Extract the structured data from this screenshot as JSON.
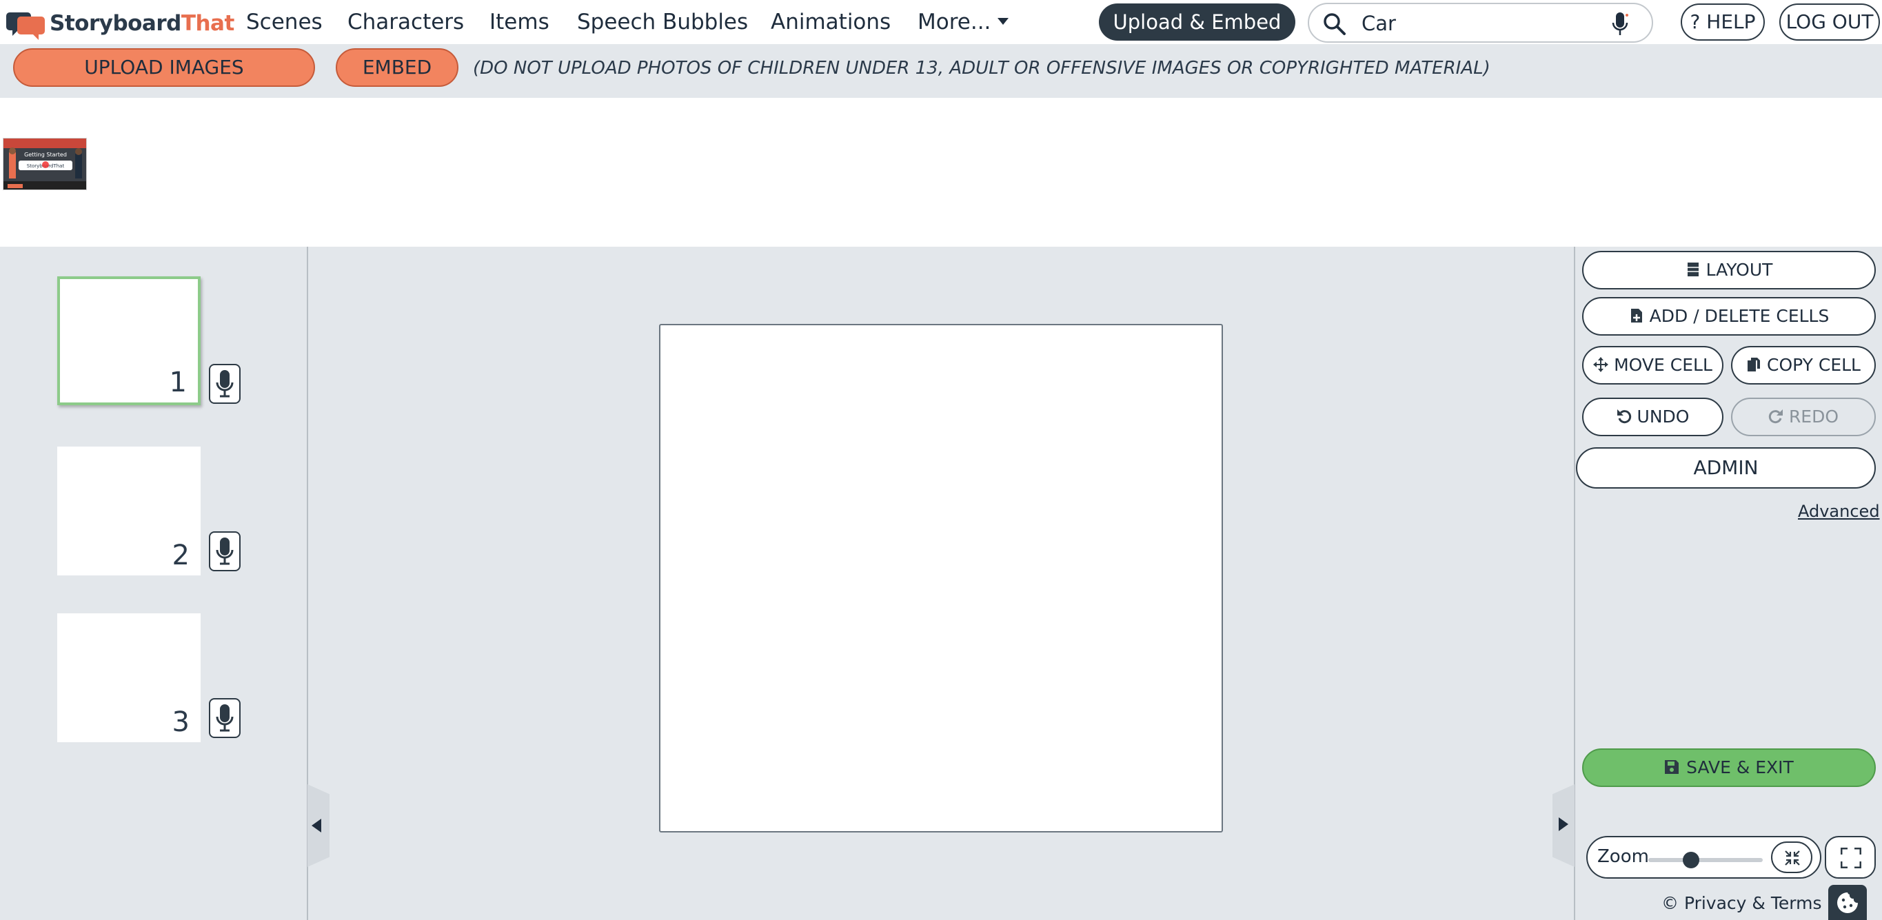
{
  "brand": {
    "name_part1": "Storyboard",
    "name_part2": "That"
  },
  "nav": {
    "scenes": "Scenes",
    "characters": "Characters",
    "items": "Items",
    "speech_bubbles": "Speech Bubbles",
    "animations": "Animations",
    "more": "More..."
  },
  "header": {
    "upload_embed": "Upload & Embed",
    "search": {
      "value": "Car",
      "icon": "search-icon",
      "voice_icon": "microphone-icon"
    },
    "help": "? HELP",
    "logout": "LOG OUT"
  },
  "upload_strip": {
    "upload_images": "UPLOAD IMAGES",
    "embed": "EMBED",
    "warning": "(DO NOT UPLOAD PHOTOS OF CHILDREN UNDER 13, ADULT OR OFFENSIVE IMAGES OR COPYRIGHTED MATERIAL)"
  },
  "library": {
    "thumbnail": {
      "title": "Getting Started",
      "brand": "StoryboardThat"
    }
  },
  "cells": [
    {
      "number": "1",
      "active": true
    },
    {
      "number": "2",
      "active": false
    },
    {
      "number": "3",
      "active": false
    }
  ],
  "tools": {
    "layout": "LAYOUT",
    "add_delete_cells": "ADD / DELETE CELLS",
    "move_cell": "MOVE CELL",
    "copy_cell": "COPY CELL",
    "undo": "UNDO",
    "redo": "REDO",
    "admin": "ADMIN",
    "advanced": "Advanced",
    "save_exit": "SAVE & EXIT"
  },
  "zoom": {
    "label": "Zoom",
    "level": 0.35
  },
  "footer": {
    "privacy": "© Privacy & Terms"
  },
  "colors": {
    "accent_orange": "#f2845f",
    "brand_dark": "#2d3a45",
    "save_green": "#6fbf6a",
    "active_cell_border": "#8dcb8a",
    "workspace_bg": "#e3e7eb"
  }
}
